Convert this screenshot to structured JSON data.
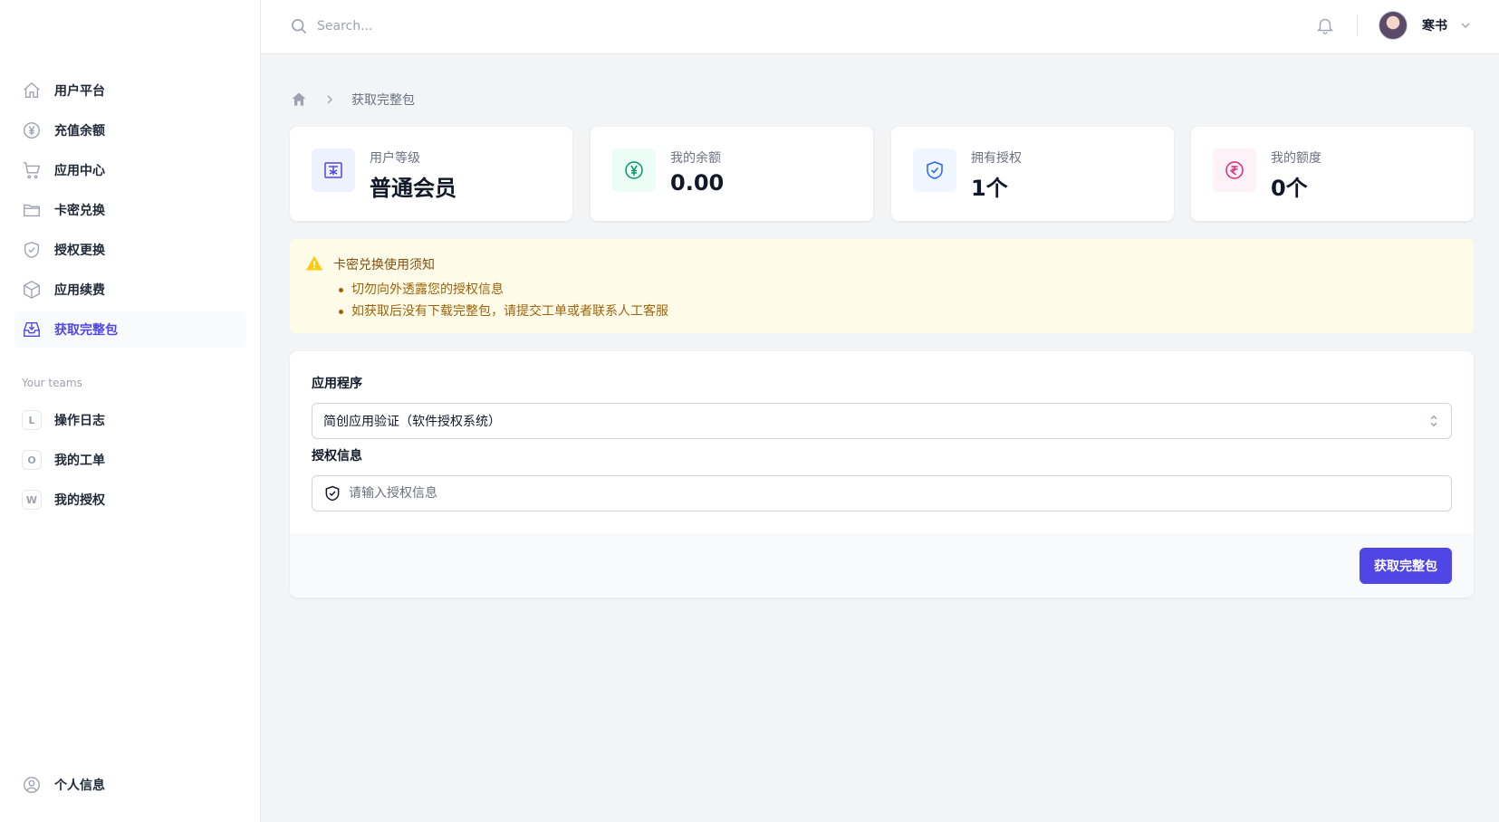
{
  "sidebar": {
    "nav": [
      {
        "label": "用户平台",
        "icon": "home-icon"
      },
      {
        "label": "充值余额",
        "icon": "yen-circle-icon"
      },
      {
        "label": "应用中心",
        "icon": "shopping-cart-icon"
      },
      {
        "label": "卡密兑换",
        "icon": "folder-icon"
      },
      {
        "label": "授权更换",
        "icon": "shield-check-icon"
      },
      {
        "label": "应用续费",
        "icon": "cube-icon"
      },
      {
        "label": "获取完整包",
        "icon": "inbox-download-icon",
        "active": true
      }
    ],
    "teams_title": "Your teams",
    "teams": [
      {
        "initial": "L",
        "label": "操作日志"
      },
      {
        "initial": "O",
        "label": "我的工单"
      },
      {
        "initial": "W",
        "label": "我的授权"
      }
    ],
    "profile_label": "个人信息"
  },
  "header": {
    "search_placeholder": "Search...",
    "user_name": "寒书"
  },
  "breadcrumb": {
    "current": "获取完整包"
  },
  "stats": [
    {
      "label": "用户等级",
      "value": "普通会员",
      "icon": "member-card-icon",
      "bg": "#eef2ff",
      "color": "#4f46e5"
    },
    {
      "label": "我的余额",
      "value": "0.00",
      "icon": "yen-circle-icon",
      "bg": "#ecfdf5",
      "color": "#059669"
    },
    {
      "label": "拥有授权",
      "value": "1个",
      "icon": "shield-check-icon",
      "bg": "#eff6ff",
      "color": "#2563eb"
    },
    {
      "label": "我的额度",
      "value": "0个",
      "icon": "rupee-circle-icon",
      "bg": "#fdf2f8",
      "color": "#db2777"
    }
  ],
  "notice": {
    "title": "卡密兑换使用须知",
    "items": [
      "切勿向外透露您的授权信息",
      "如获取后没有下载完整包，请提交工单或者联系人工客服"
    ]
  },
  "form": {
    "app_label": "应用程序",
    "app_selected": "简创应用验证（软件授权系统）",
    "auth_label": "授权信息",
    "auth_placeholder": "请输入授权信息",
    "submit_label": "获取完整包"
  },
  "colors": {
    "accent": "#4f46e5",
    "notice_bg": "#fefce8",
    "notice_text": "#a16207"
  }
}
